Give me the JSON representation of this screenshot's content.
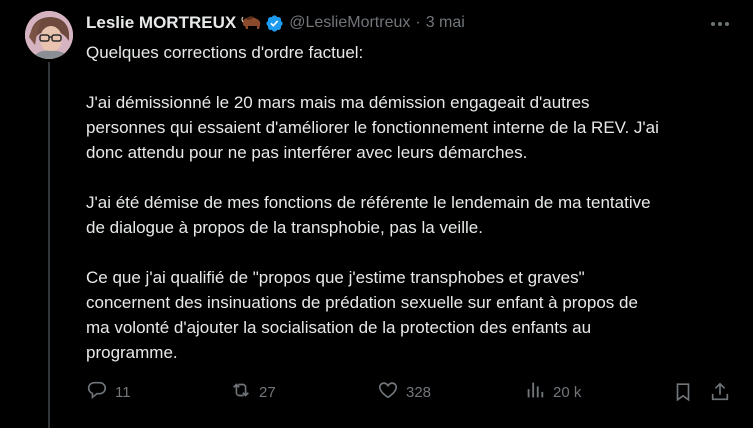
{
  "author": {
    "name": "Leslie MORTREUX",
    "handle": "@LeslieMortreux",
    "separator": "·",
    "date": "3 mai"
  },
  "tweet": {
    "paragraphs": [
      [
        "Quelques corrections d'ordre factuel:"
      ],
      [
        "J'ai démissionné le 20 mars mais ma démission engageait d'autres",
        "personnes qui essaient d'améliorer le fonctionnement interne de la REV. J'ai",
        "donc attendu pour ne pas interférer avec leurs démarches."
      ],
      [
        "J'ai été démise de mes fonctions de référente le lendemain de ma tentative",
        "de dialogue à propos de la transphobie, pas la veille."
      ],
      [
        "Ce que j'ai qualifié de \"propos que j'estime transphobes et graves\"",
        "concernent des insinuations de prédation sexuelle sur enfant à propos de",
        "ma volonté d'ajouter la socialisation de la protection des enfants au",
        "programme."
      ]
    ]
  },
  "actions": {
    "replies": "11",
    "reposts": "27",
    "likes": "328",
    "views": "20 k"
  },
  "icons": {
    "avatar": "profile-photo",
    "emoji": "bison-icon",
    "badge": "verified-badge-icon",
    "more": "more-dots-icon",
    "reply": "reply-icon",
    "repost": "repost-icon",
    "like": "heart-icon",
    "views": "views-icon",
    "bookmark": "bookmark-icon",
    "share": "share-icon"
  },
  "colors": {
    "background": "#000000",
    "text": "#e7e9ea",
    "secondary": "#71767b",
    "verified": "#1d9bf0"
  }
}
